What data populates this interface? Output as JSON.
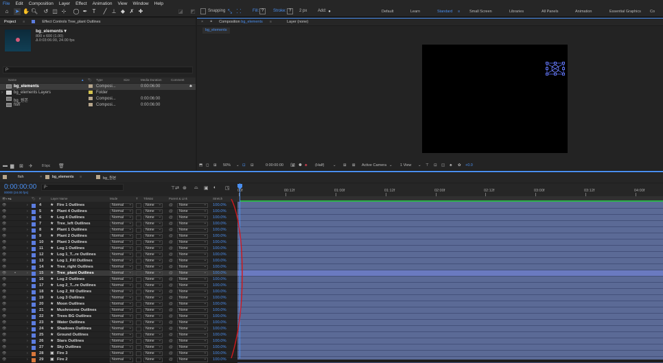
{
  "menu": [
    "File",
    "Edit",
    "Composition",
    "Layer",
    "Effect",
    "Animation",
    "View",
    "Window",
    "Help"
  ],
  "toolbar": {
    "snapping": "Snapping",
    "fill": "Fill:",
    "stroke": "Stroke:",
    "stroke_px": "2 px",
    "add": "Add:",
    "fill_box": "?",
    "stroke_box": "?"
  },
  "workspaces": [
    "Default",
    "Learn",
    "Standard",
    "Small Screen",
    "Libraries",
    "All Panels",
    "Animation",
    "Essential Graphics",
    "Co"
  ],
  "project": {
    "tab": "Project",
    "tab2": "Effect Controls Tree_plant Outlines",
    "title": "bg_elements ▾",
    "info1": "800 x 600 (1.00)",
    "info2": "Δ 0:03:06:00, 24.00 fps",
    "search_placeholder": "ρ-",
    "columns": [
      "Name",
      "Type",
      "Size",
      "Media Duration",
      "Comment"
    ],
    "items": [
      {
        "name": "bg_elements",
        "type": "Composi...",
        "dur": "0:00:06:00"
      },
      {
        "name": "bg_elements Layers",
        "type": "Folder",
        "dur": ""
      },
      {
        "name": "bg_원본",
        "type": "Composi...",
        "dur": "0:00:06:00"
      },
      {
        "name": "fish",
        "type": "Composi...",
        "dur": "0:00:06:00"
      }
    ],
    "footer_bpc": "8 bpc"
  },
  "comp": {
    "tab_prefix": "Composition",
    "tab_name": "bg_elements",
    "layer_tab": "Layer (none)",
    "subtab": "bg_elements",
    "zoom": "50%",
    "time": "0:00:00:00",
    "res": "(Half)",
    "camera": "Active Camera",
    "view": "1 View",
    "exposure": "+0.0"
  },
  "timeline": {
    "tabs": [
      "fish",
      "bg_elements",
      "bg_원본"
    ],
    "timecode": "0:00:00:00",
    "timecode_sub": "00000 (24.00 fps)",
    "search_placeholder": "ρ-",
    "columns": {
      "name": "Layer Name",
      "mode": "Mode",
      "t": "T",
      "trkmat": "TrkMat",
      "parent": "Parent & Link",
      "stretch": "Stretch"
    },
    "ruler": [
      "00f",
      "00:12f",
      "01:00f",
      "01:12f",
      "02:00f",
      "02:12f",
      "03:00f",
      "03:12f",
      "04:00f"
    ],
    "layers": [
      {
        "num": "4",
        "name": "Fire 1 Outlines"
      },
      {
        "num": "5",
        "name": "Plant 4 Outlines"
      },
      {
        "num": "6",
        "name": "Log 4 Outlines"
      },
      {
        "num": "7",
        "name": "Tree_left Outlines"
      },
      {
        "num": "8",
        "name": "Plant 1 Outlines"
      },
      {
        "num": "9",
        "name": "Plant 2 Outlines"
      },
      {
        "num": "10",
        "name": "Plant 3 Outlines"
      },
      {
        "num": "11",
        "name": "Log 1 Outlines"
      },
      {
        "num": "12",
        "name": "Log 1_T...re Outlines"
      },
      {
        "num": "13",
        "name": "Log 1_Fill Outlines"
      },
      {
        "num": "14",
        "name": "Tree_right Outlines"
      },
      {
        "num": "15",
        "name": "Tree_plant Outlines"
      },
      {
        "num": "16",
        "name": "Log 2 Outlines"
      },
      {
        "num": "17",
        "name": "Log 2_T...re Outlines"
      },
      {
        "num": "18",
        "name": "Log 2_fill Outlines"
      },
      {
        "num": "19",
        "name": "Log 3 Outlines"
      },
      {
        "num": "20",
        "name": "Moon Outlines"
      },
      {
        "num": "21",
        "name": "Mushroome Outlines"
      },
      {
        "num": "22",
        "name": "Trees BG Outlines"
      },
      {
        "num": "23",
        "name": "Water Outlines"
      },
      {
        "num": "24",
        "name": "Shadows Outlines"
      },
      {
        "num": "25",
        "name": "Ground Outlines"
      },
      {
        "num": "26",
        "name": "Stars Outlines"
      },
      {
        "num": "27",
        "name": "Sky Outlines"
      },
      {
        "num": "28",
        "name": "Fire 3"
      },
      {
        "num": "29",
        "name": "Fire 2"
      }
    ],
    "mode_value": "Normal",
    "none_value": "None",
    "stretch_value": "100.0%"
  },
  "colors": {
    "accent": "#4a8ff0",
    "layer_label": "#5c7de0",
    "track": "#5b6a96"
  }
}
